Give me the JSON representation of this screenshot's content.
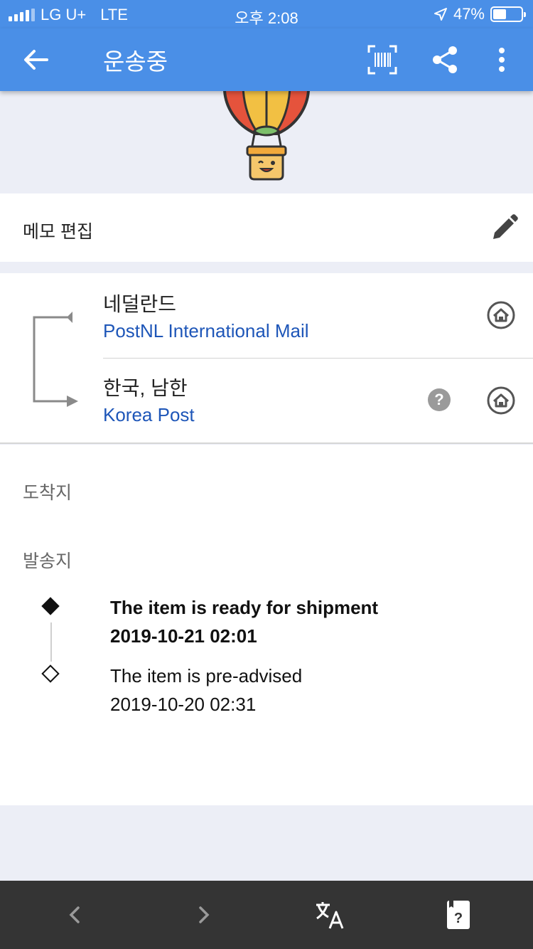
{
  "status_bar": {
    "carrier": "LG U+",
    "network": "LTE",
    "time": "오후 2:08",
    "battery": "47%",
    "battery_level": 0.47
  },
  "app_bar": {
    "title": "운송중",
    "icons": [
      "back-arrow-icon",
      "barcode-scan-icon",
      "share-icon",
      "more-vert-icon"
    ]
  },
  "memo": {
    "label": "메모 편집",
    "icon": "pencil-icon"
  },
  "route": {
    "origin": {
      "country": "네덜란드",
      "carrier": "PostNL International Mail"
    },
    "destination": {
      "country": "한국, 남한",
      "carrier": "Korea Post"
    },
    "help_symbol": "?"
  },
  "sections": {
    "destination_label": "도착지",
    "origin_label": "발송지"
  },
  "events": [
    {
      "description": "The item is ready for shipment",
      "datetime": "2019-10-21 02:01",
      "current": true
    },
    {
      "description": "The item is pre-advised",
      "datetime": "2019-10-20 02:31",
      "current": false
    }
  ],
  "toolbar": {
    "icons": [
      "chevron-left-icon",
      "chevron-right-icon",
      "translate-icon",
      "help-book-icon"
    ]
  },
  "colors": {
    "primary": "#4a8fe7",
    "link": "#1e56b8",
    "background": "#eceef6",
    "toolbar": "#343434"
  }
}
